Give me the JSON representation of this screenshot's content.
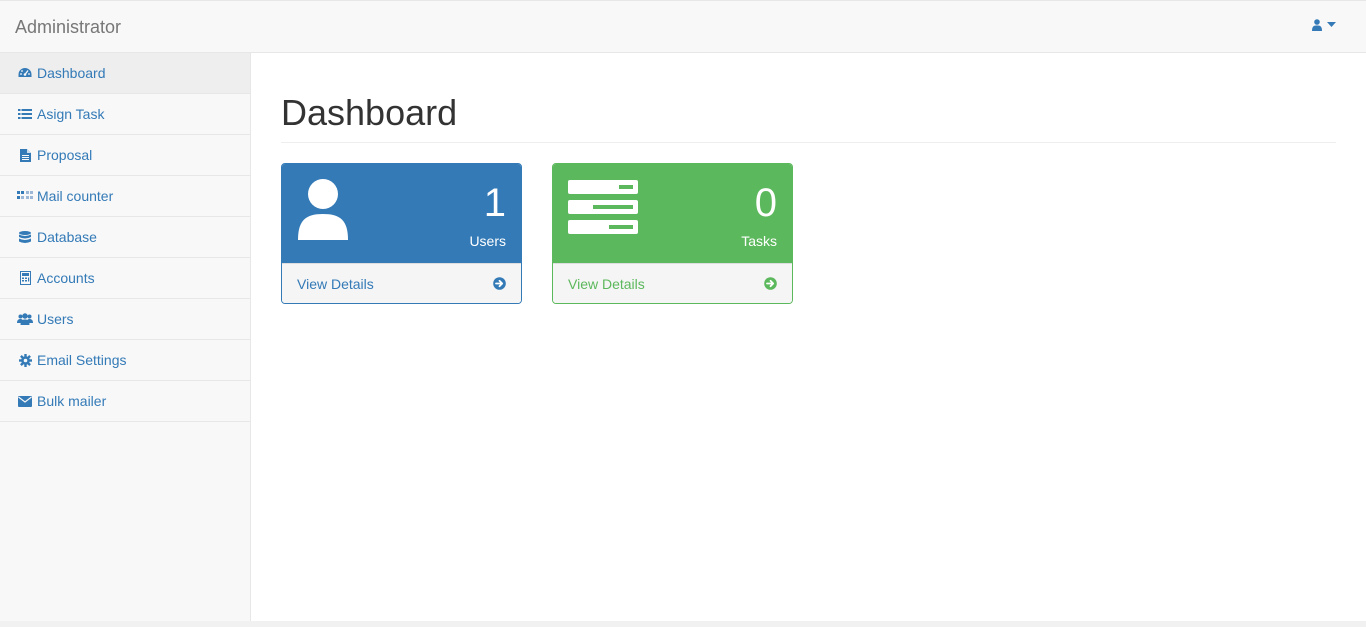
{
  "navbar": {
    "brand": "Administrator",
    "user_icon": "user-icon",
    "caret_icon": "caret-down-icon"
  },
  "sidebar": {
    "items": [
      {
        "label": "Dashboard",
        "icon": "dashboard-icon",
        "active": true
      },
      {
        "label": "Asign Task",
        "icon": "list-icon"
      },
      {
        "label": "Proposal",
        "icon": "file-text-icon"
      },
      {
        "label": "Mail counter",
        "icon": "th-icon"
      },
      {
        "label": "Database",
        "icon": "database-icon"
      },
      {
        "label": "Accounts",
        "icon": "calculator-icon"
      },
      {
        "label": "Users",
        "icon": "users-icon"
      },
      {
        "label": "Email Settings",
        "icon": "gear-icon"
      },
      {
        "label": "Bulk mailer",
        "icon": "envelope-icon"
      }
    ]
  },
  "main": {
    "title": "Dashboard",
    "panels": [
      {
        "count": "1",
        "label": "Users",
        "footer": "View Details",
        "icon": "user-icon",
        "color": "#337ab7"
      },
      {
        "count": "0",
        "label": "Tasks",
        "footer": "View Details",
        "icon": "tasks-icon",
        "color": "#5cb85c"
      }
    ]
  },
  "colors": {
    "primary": "#337ab7",
    "success": "#5cb85c",
    "navbar_bg": "#f8f8f8",
    "brand_text": "#777777"
  }
}
